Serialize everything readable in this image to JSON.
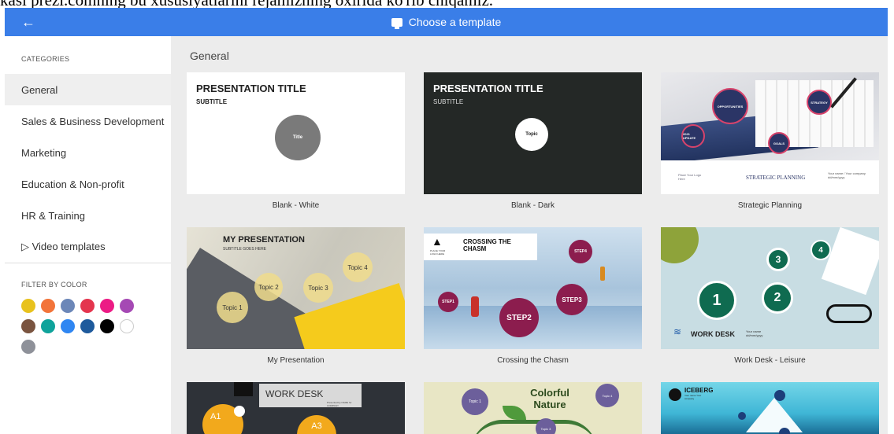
{
  "caption": "kasi prezi.comning bu xususiyatlarini rejamizning oxirida ko'rib chiqamiz.",
  "topbar": {
    "title": "Choose a template",
    "back_symbol": "←"
  },
  "sidebar": {
    "categories_heading": "CATEGORIES",
    "categories": [
      {
        "label": "General",
        "active": true
      },
      {
        "label": "Sales & Business Development",
        "active": false
      },
      {
        "label": "Marketing",
        "active": false
      },
      {
        "label": "Education & Non-profit",
        "active": false
      },
      {
        "label": "HR & Training",
        "active": false
      },
      {
        "label": "▷ Video templates",
        "active": false
      }
    ],
    "filter_heading": "FILTER BY COLOR",
    "colors": [
      "#e8c21e",
      "#f2743a",
      "#6c87b8",
      "#e4354e",
      "#ec1b85",
      "#a549b4",
      "#7a5440",
      "#0fa39b",
      "#2f86f2",
      "#1e5a9c",
      "#000000",
      "#ffffff",
      "#8e9199"
    ]
  },
  "main": {
    "section_title": "General",
    "templates": [
      {
        "label": "Blank - White",
        "title": "PRESENTATION TITLE",
        "subtitle": "SUBTITLE",
        "topic": "Title"
      },
      {
        "label": "Blank - Dark",
        "title": "PRESENTATION TITLE",
        "subtitle": "SUBTITLE",
        "topic": "Topic"
      },
      {
        "label": "Strategic Planning",
        "title": "STRATEGIC PLANNING",
        "nodes": [
          "OPPORTUNITIES",
          "STRATEGY",
          "2021 UPDATE",
          "GOALS"
        ],
        "logo_text": "Place Your Logo Here",
        "info_text": "Your name / Your company dd/mm/yyyy"
      },
      {
        "label": "My Presentation",
        "title": "MY PRESENTATION",
        "subtitle": "SUBTITLE GOES HERE",
        "topics": [
          "Topic 1",
          "Topic 2",
          "Topic 3",
          "Topic 4"
        ]
      },
      {
        "label": "Crossing the Chasm",
        "title": "CROSSING THE CHASM",
        "logo_text": "PLACE YOUR LOGO HERE",
        "steps": [
          "STEP1",
          "STEP2",
          "STEP3",
          "STEP4"
        ]
      },
      {
        "label": "Work Desk - Leisure",
        "title": "WORK DESK",
        "info_text": "Your name dd/mm/yyyy",
        "numbers": [
          "1",
          "2",
          "3",
          "4"
        ]
      },
      {
        "label": "",
        "title": "WORK DESK",
        "info_text": "Presented by NAME for COMPANY",
        "badges": [
          "A1",
          "A3"
        ]
      },
      {
        "label": "",
        "title": "Colorful Nature",
        "topics": [
          "Topic 1",
          "Topic 3",
          "Topic 4"
        ]
      },
      {
        "label": "",
        "title": "ICEBERG",
        "info_text": "Your name Your company"
      }
    ]
  }
}
